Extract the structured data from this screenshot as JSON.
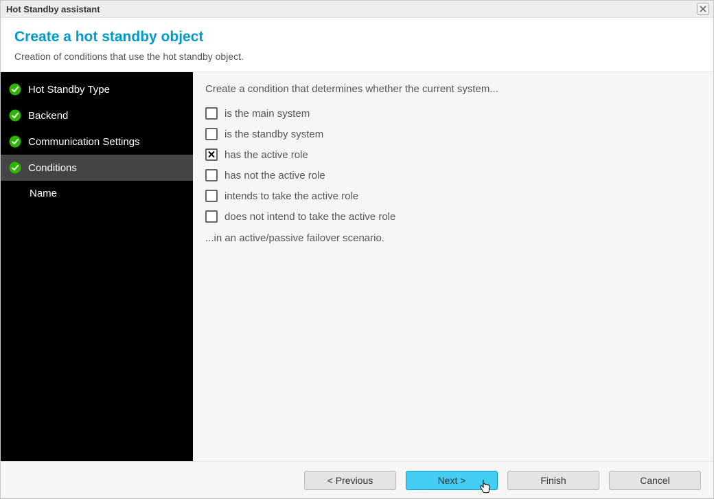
{
  "titlebar": {
    "title": "Hot Standby assistant"
  },
  "header": {
    "title": "Create a hot standby object",
    "subtitle": "Creation of conditions that use the hot standby object."
  },
  "sidebar": {
    "steps": [
      {
        "label": "Hot Standby Type",
        "completed": true,
        "active": false
      },
      {
        "label": "Backend",
        "completed": true,
        "active": false
      },
      {
        "label": "Communication Settings",
        "completed": true,
        "active": false
      },
      {
        "label": "Conditions",
        "completed": true,
        "active": true
      },
      {
        "label": "Name",
        "completed": false,
        "active": false,
        "sub": true
      }
    ]
  },
  "content": {
    "lead": "Create a condition that determines whether the current system...",
    "options": [
      {
        "label": "is the main system",
        "checked": false
      },
      {
        "label": "is the standby system",
        "checked": false
      },
      {
        "label": "has the active role",
        "checked": true
      },
      {
        "label": "has not the active role",
        "checked": false
      },
      {
        "label": "intends to take the active role",
        "checked": false
      },
      {
        "label": "does not intend to take the active role",
        "checked": false
      }
    ],
    "trail": "...in an active/passive failover scenario."
  },
  "buttons": {
    "previous": "< Previous",
    "next": "Next >",
    "finish": "Finish",
    "cancel": "Cancel"
  }
}
